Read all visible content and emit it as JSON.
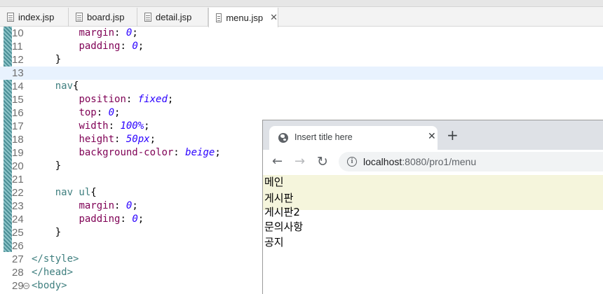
{
  "editor": {
    "tabs": [
      {
        "label": "index.jsp"
      },
      {
        "label": "board.jsp"
      },
      {
        "label": "detail.jsp"
      },
      {
        "label": "menu.jsp",
        "close": "✕"
      }
    ],
    "lines": [
      {
        "n": "10"
      },
      {
        "n": "11"
      },
      {
        "n": "12"
      },
      {
        "n": "13"
      },
      {
        "n": "14"
      },
      {
        "n": "15"
      },
      {
        "n": "16"
      },
      {
        "n": "17"
      },
      {
        "n": "18"
      },
      {
        "n": "19"
      },
      {
        "n": "20"
      },
      {
        "n": "21"
      },
      {
        "n": "22"
      },
      {
        "n": "23"
      },
      {
        "n": "24"
      },
      {
        "n": "25"
      },
      {
        "n": "26"
      },
      {
        "n": "27"
      },
      {
        "n": "28"
      },
      {
        "n": "29"
      }
    ],
    "code": {
      "margin": "margin",
      "padding": "padding",
      "zero": "0",
      "nav": "nav",
      "nav_ul": "nav ul",
      "position": "position",
      "fixed": "fixed",
      "top": "top",
      "width": "width",
      "w100": "100%",
      "height": "height",
      "h50": "50px",
      "bgcolor": "background-color",
      "beige": "beige",
      "style_close": "</style>",
      "head_close": "</head>",
      "body_open": "<body>"
    }
  },
  "browser": {
    "tab_title": "Insert title here",
    "tab_close": "✕",
    "new_tab": "+",
    "url_host": "localhost",
    "url_rest": ":8080/pro1/menu",
    "menu_items": [
      "메인",
      "게시판",
      "게시판2",
      "문의사항",
      "공지"
    ]
  },
  "colors": {
    "nav_background": "#f5f5dc",
    "current_line_highlight": "#e8f2fe",
    "keyword": "#7f0055",
    "value": "#2a00ff"
  }
}
